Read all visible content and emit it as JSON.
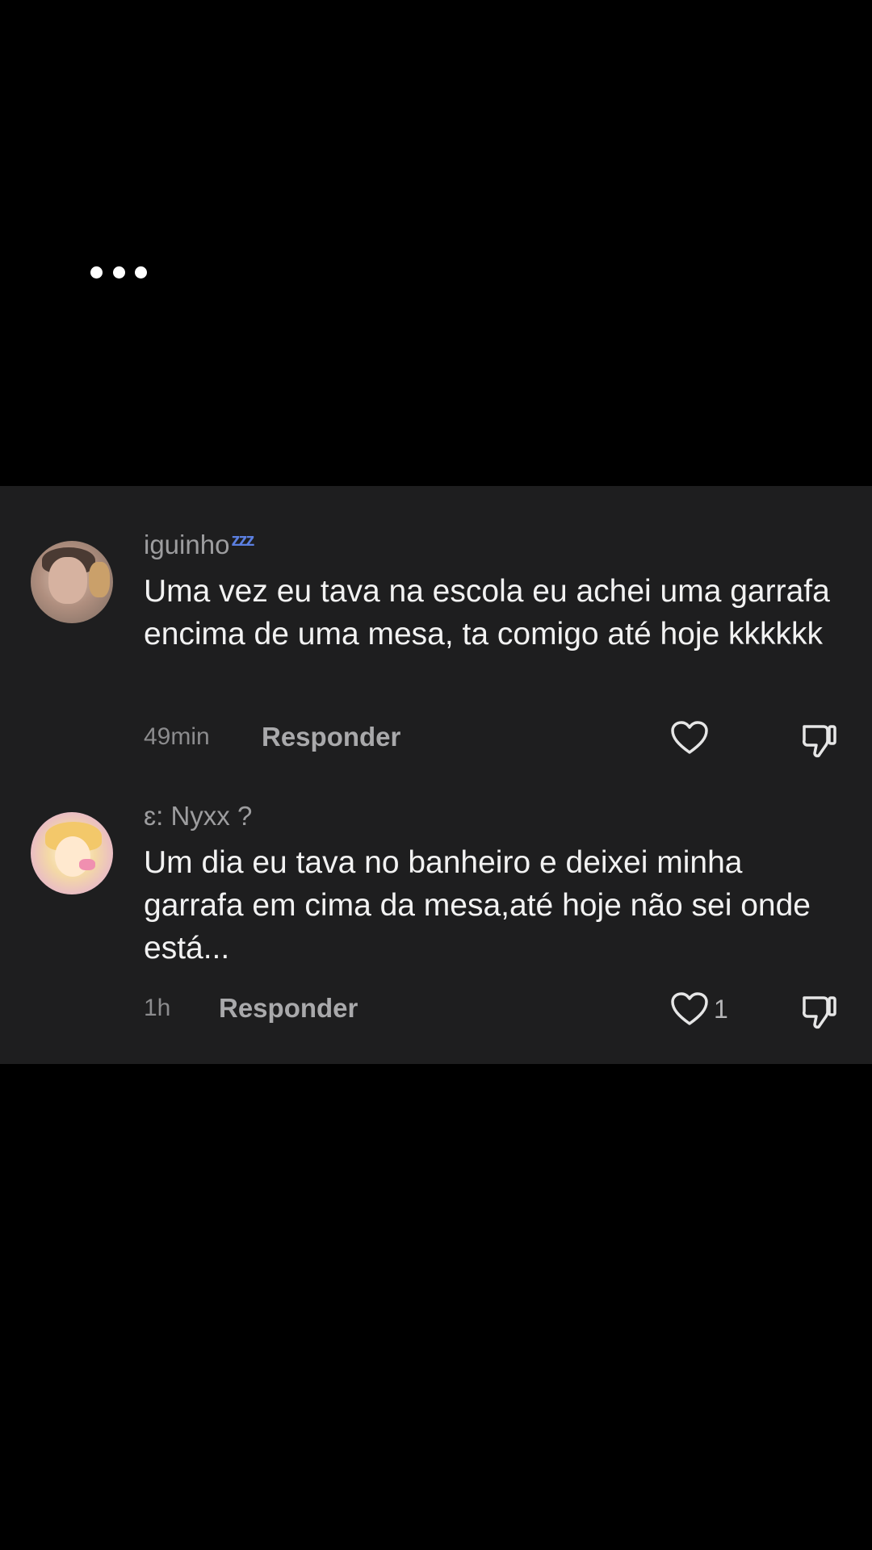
{
  "comments": [
    {
      "username": "iguinho",
      "username_badge": "zzz",
      "text": "Uma vez eu tava na escola eu achei uma garrafa encima de uma mesa, ta comigo até hoje kkkkkk",
      "timestamp": "49min",
      "reply_label": "Responder",
      "like_count": "",
      "avatar": "avatar-photo"
    },
    {
      "username": "ɛ: Nyxx ?",
      "text": "Um dia eu tava no banheiro e deixei minha garrafa em cima da mesa,até hoje não sei onde está...",
      "timestamp": "1h",
      "reply_label": "Responder",
      "like_count": "1",
      "avatar": "avatar-drawing"
    }
  ],
  "icons": {
    "more": "more-horizontal-icon",
    "like": "heart-outline-icon",
    "dislike": "thumbs-down-icon",
    "badge": "zzz-icon"
  },
  "colors": {
    "panel_bg": "#1e1e1f",
    "page_bg": "#000000",
    "badge": "#5b7fe0",
    "text_primary": "#f2f2f2",
    "text_secondary": "#9d9d9f"
  }
}
